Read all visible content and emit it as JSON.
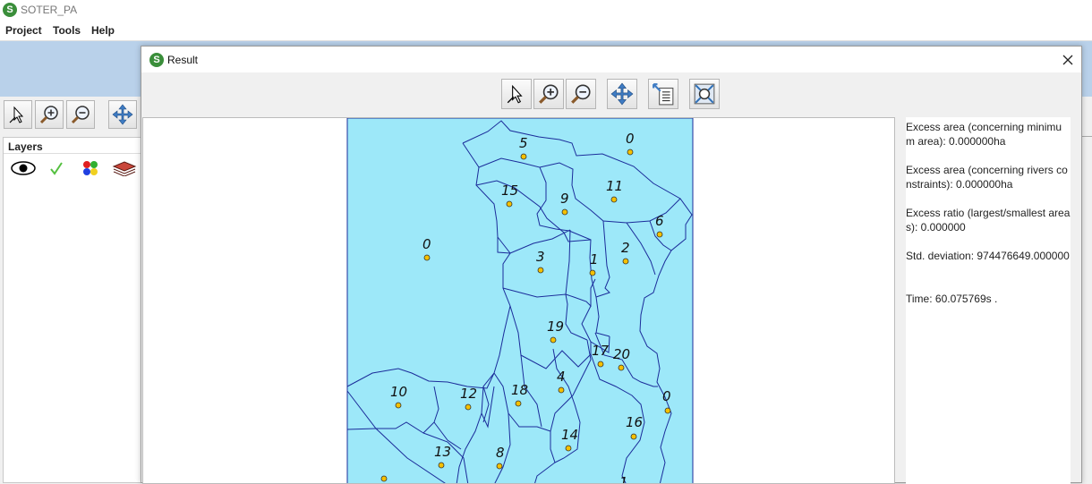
{
  "app": {
    "title": "SOTER_PA",
    "icon": "soter-logo-icon"
  },
  "menu": [
    "Project",
    "Tools",
    "Help"
  ],
  "main_toolbar": [
    "select-pointer-icon",
    "zoom-in-icon",
    "zoom-out-icon",
    "pan-icon"
  ],
  "layers": {
    "header": "Layers",
    "icons": [
      "visibility-eye-icon",
      "checkmark-icon",
      "colors-icon",
      "layer-stack-icon"
    ]
  },
  "dialog": {
    "title": "Result",
    "close_icon": "close-icon",
    "toolbar": [
      "select-pointer-icon",
      "zoom-in-icon",
      "zoom-out-icon",
      "pan-icon",
      "legend-icon",
      "zoom-extent-icon"
    ]
  },
  "map": {
    "water_color": "#9de8f9",
    "outline_color": "#1b2c9a",
    "point_color": "#f5c000",
    "labels": [
      "5",
      "0",
      "15",
      "9",
      "11",
      "6",
      "0",
      "3",
      "1",
      "2",
      "19",
      "17",
      "20",
      "4",
      "0",
      "10",
      "12",
      "18",
      "16",
      "14",
      "13",
      "8",
      "1"
    ]
  },
  "results": {
    "excess_area_min": "Excess area (concerning minimum area): 0.000000ha",
    "excess_area_rivers": "Excess area (concerning rivers constraints): 0.000000ha",
    "excess_ratio": "Excess ratio (largest/smallest areas): 0.000000",
    "std_deviation": "Std. deviation: 974476649.000000",
    "time": "Time: 60.075769s ."
  }
}
